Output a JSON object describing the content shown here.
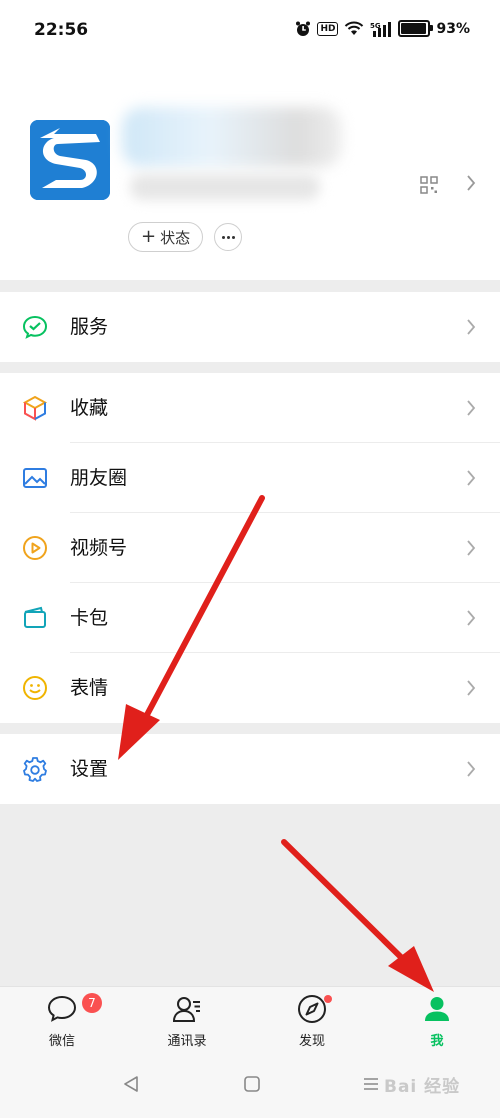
{
  "status_bar": {
    "time": "22:56",
    "hd": "HD",
    "network": "5G",
    "battery_percent": "93%",
    "battery_level": 0.93,
    "icons": [
      "alarm-icon",
      "hd-icon",
      "wifi-icon",
      "signal-icon",
      "battery-icon"
    ]
  },
  "profile": {
    "avatar_icon": "app-logo-s-icon",
    "status_button_label": "状态",
    "more_icon": "more-dots-icon",
    "qr_icon": "qr-code-icon"
  },
  "menu": {
    "service": {
      "label": "服务",
      "icon": "wechat-pay-icon",
      "color": "#07c160"
    },
    "favorites": {
      "label": "收藏",
      "icon": "cube-icon"
    },
    "moments": {
      "label": "朋友圈",
      "icon": "image-icon",
      "color": "#2f7de1"
    },
    "channels": {
      "label": "视频号",
      "icon": "play-icon",
      "color": "#f0a31c"
    },
    "cards": {
      "label": "卡包",
      "icon": "wallet-icon",
      "color": "#12a4b8"
    },
    "stickers": {
      "label": "表情",
      "icon": "smile-icon",
      "color": "#f0b400"
    },
    "settings": {
      "label": "设置",
      "icon": "gear-icon",
      "color": "#2f7de1"
    }
  },
  "tabbar": {
    "chats": {
      "label": "微信",
      "badge": "7",
      "icon": "chat-bubble-icon"
    },
    "contacts": {
      "label": "通讯录",
      "icon": "contacts-icon"
    },
    "discover": {
      "label": "发现",
      "icon": "compass-icon"
    },
    "me": {
      "label": "我",
      "icon": "person-icon",
      "color": "#07c160"
    }
  },
  "navbar": {
    "icons": [
      "back-triangle-icon",
      "home-square-icon",
      "recents-menu-icon"
    ]
  },
  "watermark": "Bai 经验",
  "annotations": {
    "color": "#e0201b",
    "arrows": [
      "arrow-to-settings",
      "arrow-to-me-tab"
    ]
  }
}
